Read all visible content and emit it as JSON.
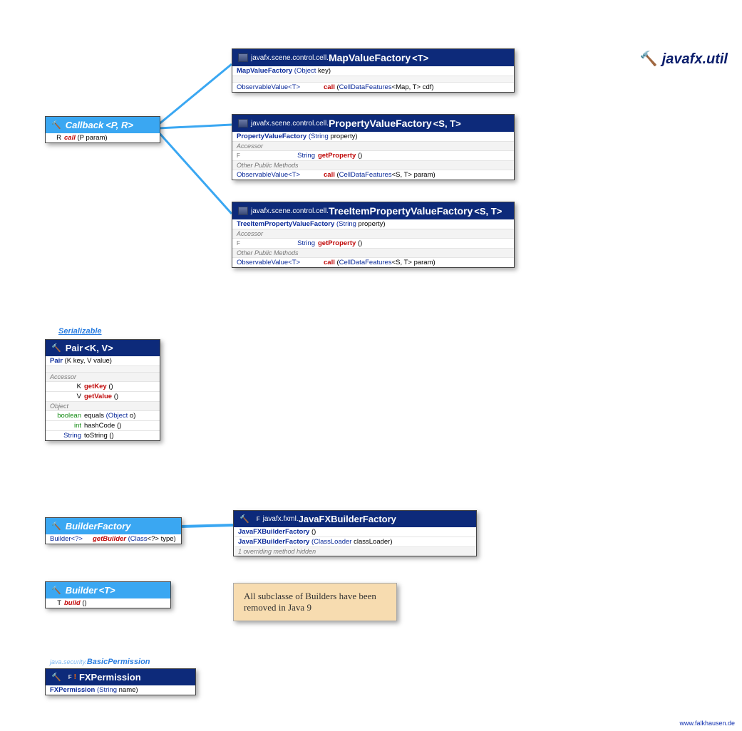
{
  "package_title": "javafx.util",
  "footer": "www.falkhausen.de",
  "callback": {
    "name": "Callback",
    "generics": "<P, R>",
    "method": {
      "ret": "R",
      "name": "call",
      "params": "(P param)"
    }
  },
  "mapvf": {
    "pkg": "javafx.scene.control.cell.",
    "name": "MapValueFactory",
    "generics": "<T>",
    "ctor": {
      "name": "MapValueFactory",
      "params": "(Object key)"
    },
    "call": {
      "ret": "ObservableValue<T>",
      "name": "call",
      "params_pre": "(",
      "params_type": "CellDataFeatures",
      "params_gen": "<Map, T>",
      "params_post": " cdf)"
    }
  },
  "propvf": {
    "pkg": "javafx.scene.control.cell.",
    "name": "PropertyValueFactory",
    "generics": "<S, T>",
    "ctor": {
      "name": "PropertyValueFactory",
      "params": "(String property)"
    },
    "sect_accessor": "Accessor",
    "getProperty": {
      "ret": "String",
      "name": "getProperty",
      "params": "()"
    },
    "sect_other": "Other Public Methods",
    "call": {
      "ret": "ObservableValue<T>",
      "name": "call",
      "params_pre": "(",
      "params_type": "CellDataFeatures",
      "params_gen": "<S, T>",
      "params_post": " param)"
    }
  },
  "treepvf": {
    "pkg": "javafx.scene.control.cell.",
    "name": "TreeItemPropertyValueFactory",
    "generics": "<S, T>",
    "ctor": {
      "name": "TreeItemPropertyValueFactory",
      "params": "(String property)"
    },
    "sect_accessor": "Accessor",
    "getProperty": {
      "ret": "String",
      "name": "getProperty",
      "params": "()"
    },
    "sect_other": "Other Public Methods",
    "call": {
      "ret": "ObservableValue<T>",
      "name": "call",
      "params_pre": "(",
      "params_type": "CellDataFeatures",
      "params_gen": "<S, T>",
      "params_post": " param)"
    }
  },
  "serializable_label": "Serializable",
  "pair": {
    "name": "Pair",
    "generics": "<K, V>",
    "ctor": {
      "name": "Pair",
      "params": "(K key, V value)"
    },
    "sect_accessor": "Accessor",
    "getKey": {
      "ret": "K",
      "name": "getKey",
      "params": "()"
    },
    "getValue": {
      "ret": "V",
      "name": "getValue",
      "params": "()"
    },
    "sect_object": "Object",
    "equals": {
      "ret": "boolean",
      "name": "equals",
      "params": "(Object o)"
    },
    "hashCode": {
      "ret": "int",
      "name": "hashCode",
      "params": "()"
    },
    "toString": {
      "ret": "String",
      "name": "toString",
      "params": "()"
    }
  },
  "builderfactory": {
    "name": "BuilderFactory",
    "method": {
      "ret": "Builder<?>",
      "name": "getBuilder",
      "params": "(Class<?> type)"
    }
  },
  "javafxbf": {
    "pkg": "javafx.fxml.",
    "name": "JavaFXBuilderFactory",
    "ctor1": {
      "name": "JavaFXBuilderFactory",
      "params": "()"
    },
    "ctor2": {
      "name": "JavaFXBuilderFactory",
      "params": "(ClassLoader classLoader)"
    },
    "hidden": "1 overriding method hidden"
  },
  "builder": {
    "name": "Builder",
    "generics": "<T>",
    "method": {
      "ret": "T",
      "name": "build",
      "params": "()"
    }
  },
  "note": "All subclasse of Builders have been removed in Java 9",
  "basicperm_label_pkg": "java.security.",
  "basicperm_label": "BasicPermission",
  "fxperm": {
    "name": "FXPermission",
    "ctor": {
      "name": "FXPermission",
      "params": "(String name)"
    }
  }
}
